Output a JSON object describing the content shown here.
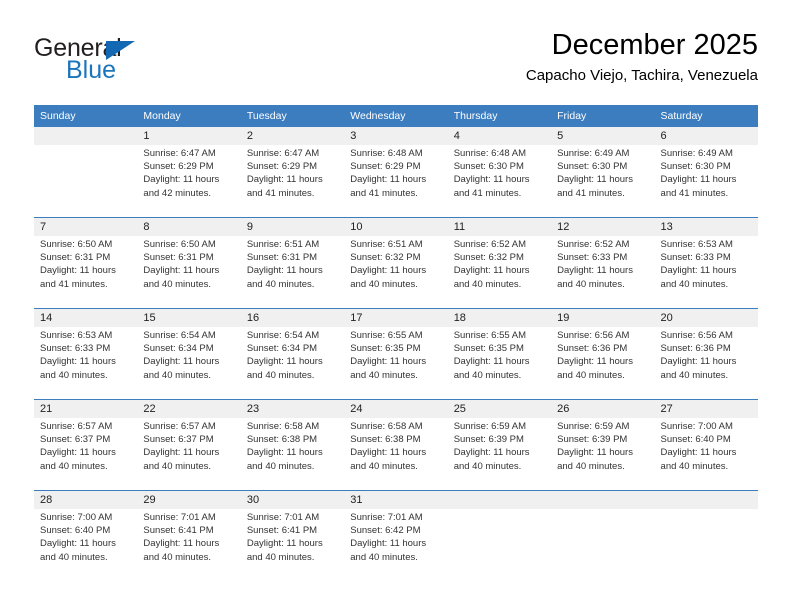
{
  "logo": {
    "line1": "General",
    "line2": "Blue",
    "triangle_color": "#1268b3",
    "blue_color": "#1b75bb"
  },
  "header": {
    "title": "December 2025",
    "subtitle": "Capacho Viejo, Tachira, Venezuela"
  },
  "theme": {
    "header_bg": "#3b7dbf",
    "header_text": "#ffffff",
    "daynum_bg": "#f0f0f0",
    "cell_bg": "#ffffff",
    "body_text": "#333333"
  },
  "calendar": {
    "weekday_headers": [
      "Sunday",
      "Monday",
      "Tuesday",
      "Wednesday",
      "Thursday",
      "Friday",
      "Saturday"
    ],
    "weeks": [
      [
        {
          "day": "",
          "lines": []
        },
        {
          "day": "1",
          "lines": [
            "Sunrise: 6:47 AM",
            "Sunset: 6:29 PM",
            "Daylight: 11 hours",
            "and 42 minutes."
          ]
        },
        {
          "day": "2",
          "lines": [
            "Sunrise: 6:47 AM",
            "Sunset: 6:29 PM",
            "Daylight: 11 hours",
            "and 41 minutes."
          ]
        },
        {
          "day": "3",
          "lines": [
            "Sunrise: 6:48 AM",
            "Sunset: 6:29 PM",
            "Daylight: 11 hours",
            "and 41 minutes."
          ]
        },
        {
          "day": "4",
          "lines": [
            "Sunrise: 6:48 AM",
            "Sunset: 6:30 PM",
            "Daylight: 11 hours",
            "and 41 minutes."
          ]
        },
        {
          "day": "5",
          "lines": [
            "Sunrise: 6:49 AM",
            "Sunset: 6:30 PM",
            "Daylight: 11 hours",
            "and 41 minutes."
          ]
        },
        {
          "day": "6",
          "lines": [
            "Sunrise: 6:49 AM",
            "Sunset: 6:30 PM",
            "Daylight: 11 hours",
            "and 41 minutes."
          ]
        }
      ],
      [
        {
          "day": "7",
          "lines": [
            "Sunrise: 6:50 AM",
            "Sunset: 6:31 PM",
            "Daylight: 11 hours",
            "and 41 minutes."
          ]
        },
        {
          "day": "8",
          "lines": [
            "Sunrise: 6:50 AM",
            "Sunset: 6:31 PM",
            "Daylight: 11 hours",
            "and 40 minutes."
          ]
        },
        {
          "day": "9",
          "lines": [
            "Sunrise: 6:51 AM",
            "Sunset: 6:31 PM",
            "Daylight: 11 hours",
            "and 40 minutes."
          ]
        },
        {
          "day": "10",
          "lines": [
            "Sunrise: 6:51 AM",
            "Sunset: 6:32 PM",
            "Daylight: 11 hours",
            "and 40 minutes."
          ]
        },
        {
          "day": "11",
          "lines": [
            "Sunrise: 6:52 AM",
            "Sunset: 6:32 PM",
            "Daylight: 11 hours",
            "and 40 minutes."
          ]
        },
        {
          "day": "12",
          "lines": [
            "Sunrise: 6:52 AM",
            "Sunset: 6:33 PM",
            "Daylight: 11 hours",
            "and 40 minutes."
          ]
        },
        {
          "day": "13",
          "lines": [
            "Sunrise: 6:53 AM",
            "Sunset: 6:33 PM",
            "Daylight: 11 hours",
            "and 40 minutes."
          ]
        }
      ],
      [
        {
          "day": "14",
          "lines": [
            "Sunrise: 6:53 AM",
            "Sunset: 6:33 PM",
            "Daylight: 11 hours",
            "and 40 minutes."
          ]
        },
        {
          "day": "15",
          "lines": [
            "Sunrise: 6:54 AM",
            "Sunset: 6:34 PM",
            "Daylight: 11 hours",
            "and 40 minutes."
          ]
        },
        {
          "day": "16",
          "lines": [
            "Sunrise: 6:54 AM",
            "Sunset: 6:34 PM",
            "Daylight: 11 hours",
            "and 40 minutes."
          ]
        },
        {
          "day": "17",
          "lines": [
            "Sunrise: 6:55 AM",
            "Sunset: 6:35 PM",
            "Daylight: 11 hours",
            "and 40 minutes."
          ]
        },
        {
          "day": "18",
          "lines": [
            "Sunrise: 6:55 AM",
            "Sunset: 6:35 PM",
            "Daylight: 11 hours",
            "and 40 minutes."
          ]
        },
        {
          "day": "19",
          "lines": [
            "Sunrise: 6:56 AM",
            "Sunset: 6:36 PM",
            "Daylight: 11 hours",
            "and 40 minutes."
          ]
        },
        {
          "day": "20",
          "lines": [
            "Sunrise: 6:56 AM",
            "Sunset: 6:36 PM",
            "Daylight: 11 hours",
            "and 40 minutes."
          ]
        }
      ],
      [
        {
          "day": "21",
          "lines": [
            "Sunrise: 6:57 AM",
            "Sunset: 6:37 PM",
            "Daylight: 11 hours",
            "and 40 minutes."
          ]
        },
        {
          "day": "22",
          "lines": [
            "Sunrise: 6:57 AM",
            "Sunset: 6:37 PM",
            "Daylight: 11 hours",
            "and 40 minutes."
          ]
        },
        {
          "day": "23",
          "lines": [
            "Sunrise: 6:58 AM",
            "Sunset: 6:38 PM",
            "Daylight: 11 hours",
            "and 40 minutes."
          ]
        },
        {
          "day": "24",
          "lines": [
            "Sunrise: 6:58 AM",
            "Sunset: 6:38 PM",
            "Daylight: 11 hours",
            "and 40 minutes."
          ]
        },
        {
          "day": "25",
          "lines": [
            "Sunrise: 6:59 AM",
            "Sunset: 6:39 PM",
            "Daylight: 11 hours",
            "and 40 minutes."
          ]
        },
        {
          "day": "26",
          "lines": [
            "Sunrise: 6:59 AM",
            "Sunset: 6:39 PM",
            "Daylight: 11 hours",
            "and 40 minutes."
          ]
        },
        {
          "day": "27",
          "lines": [
            "Sunrise: 7:00 AM",
            "Sunset: 6:40 PM",
            "Daylight: 11 hours",
            "and 40 minutes."
          ]
        }
      ],
      [
        {
          "day": "28",
          "lines": [
            "Sunrise: 7:00 AM",
            "Sunset: 6:40 PM",
            "Daylight: 11 hours",
            "and 40 minutes."
          ]
        },
        {
          "day": "29",
          "lines": [
            "Sunrise: 7:01 AM",
            "Sunset: 6:41 PM",
            "Daylight: 11 hours",
            "and 40 minutes."
          ]
        },
        {
          "day": "30",
          "lines": [
            "Sunrise: 7:01 AM",
            "Sunset: 6:41 PM",
            "Daylight: 11 hours",
            "and 40 minutes."
          ]
        },
        {
          "day": "31",
          "lines": [
            "Sunrise: 7:01 AM",
            "Sunset: 6:42 PM",
            "Daylight: 11 hours",
            "and 40 minutes."
          ]
        },
        {
          "day": "",
          "lines": []
        },
        {
          "day": "",
          "lines": []
        },
        {
          "day": "",
          "lines": []
        }
      ]
    ]
  }
}
